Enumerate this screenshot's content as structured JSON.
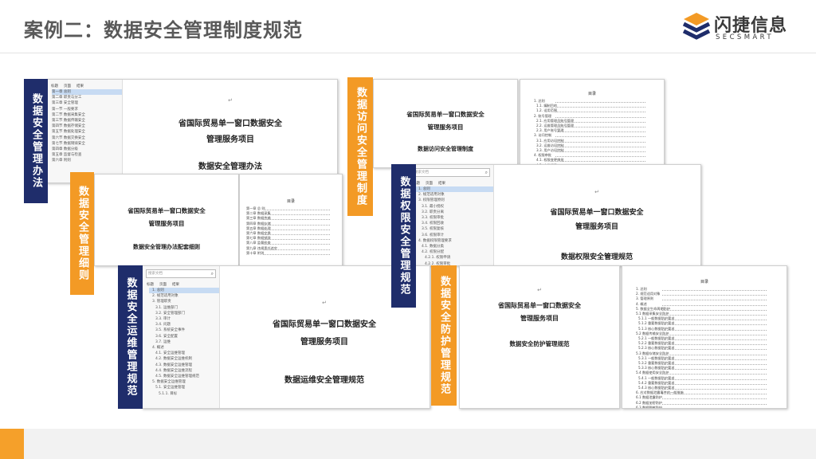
{
  "header": {
    "title": "案例二：数据安全管理制度规范"
  },
  "logo": {
    "name": "闪捷信息",
    "sub": "SECSMART"
  },
  "colors": {
    "navy": "#1f2d6b",
    "orange": "#f39a25"
  },
  "labels": {
    "l1": "数据安全管理办法",
    "l2": "数据安全管理细则",
    "l3": "数据访问安全管理制度",
    "l4": "数据权限安全管理规范",
    "l5": "数据安全运维管理规范",
    "l6": "数据安全防护管理规范"
  },
  "docs": {
    "d1": {
      "project1": "省国际贸易单一窗口数据安全",
      "project2": "管理服务项目",
      "name": "数据安全管理办法",
      "nav_tabs": [
        "标题",
        "页面",
        "结果"
      ],
      "nav_items": [
        "第一章 总则",
        "第二章 职责与分工",
        "第三章 安全管理",
        "第一节 一般要求",
        "第二节 数据采集安全",
        "第三节 数据传输安全",
        "第四节 数据存储安全",
        "第五节 数据处理安全",
        "第六节 数据交换安全",
        "第七节 数据销毁安全",
        "第四章 数据分级",
        "第五章 监督与检查",
        "第六章 附则"
      ]
    },
    "d2": {
      "project1": "省国际贸易单一窗口数据安全",
      "project2": "管理服务项目",
      "name": "数据安全管理办法配套细则",
      "toc_head": "目录",
      "toc": [
        "第一章 总 则",
        "第二章 数据采集",
        "第三章 数据传输",
        "第四章 数据存储",
        "第五章 数据处理",
        "第六章 数据交换",
        "第七章 数据销毁",
        "第八章 监督检查",
        "第九章 违规责任追究",
        "第十章 附则"
      ]
    },
    "d3": {
      "project1": "省国际贸易单一窗口数据安全",
      "project2": "管理服务项目",
      "name": "数据访问安全管理制度"
    },
    "d4": {
      "toc_head": "目录",
      "toc": [
        "1. 总则",
        "1.1. 编制目的",
        "1.2. 适用范围",
        "2. 账号管理",
        "2.1. 应用管理员账号管理",
        "2.2. 运维管理员账号管理",
        "2.3. 用户账号管理",
        "3. 访问控制",
        "3.1. 应用访问控制",
        "3.2. 运维访问控制",
        "3.3. 用户访问控制",
        "4. 权限审批",
        "4.1. 权限变更审批",
        "4.2. 审批记录"
      ]
    },
    "d5": {
      "project1": "省国际贸易单一窗口数据安全",
      "project2": "管理服务项目",
      "name": "数据权限安全管理规范",
      "search": "搜索文档",
      "nav_tabs": [
        "标题",
        "页面",
        "结果"
      ],
      "nav_items": [
        "1. 总则",
        "2. 规范适用对象",
        "3. 权限管理原则",
        "3.1. 最小授权",
        "3.2. 职责分离",
        "3.3. 权限审批",
        "3.4. 权限回收",
        "3.5. 权限复核",
        "3.6. 权限审计",
        "4. 数据权限管理要求",
        "4.1. 数据分类",
        "4.2. 权限分配",
        "4.2.1. 权限申请",
        "4.2.2. 权限审批",
        "4.3. 权限使用监控",
        "4.3.1. 权限变更"
      ]
    },
    "d6": {
      "project1": "省国际贸易单一窗口数据安全",
      "project2": "管理服务项目",
      "name": "数据运维安全管理规范",
      "search": "搜索文档",
      "nav_tabs": [
        "标题",
        "页面",
        "结果"
      ],
      "nav_items": [
        "1. 总则",
        "2. 规范适用对象",
        "3. 管理职责",
        "3.1. 运维部门",
        "3.2. 安全管理部门",
        "3.3. 审计",
        "3.4. 问题",
        "3.5. 系统安全事件",
        "3.6. 安全配置",
        "3.7. 运维",
        "4. 概述",
        "4.1. 安全运维管理",
        "4.2. 数据安全运维机制",
        "4.3. 数据安全运维管理",
        "4.4. 数据安全运维流程",
        "4.5. 数据安全运维管理规范",
        "5. 数据安全运维管理",
        "5.1. 安全运维管理",
        "5.1.1. 目标"
      ]
    },
    "d7": {
      "project1": "省国际贸易单一窗口数据安全",
      "project2": "管理服务项目",
      "name": "数据安全防护管理规范"
    },
    "d8": {
      "toc_head": "目录",
      "toc": [
        "1. 总则",
        "2. 规范适用对象",
        "3. 管理原则",
        "4. 概述",
        "5. 数据全生命周期防护",
        "5.1 数据采集安全防护",
        "5.1.1 一般数据防护要求",
        "5.1.2 重要数据防护要求",
        "5.1.3 核心数据防护要求",
        "5.2 数据传输安全防护",
        "5.2.1 一般数据防护要求",
        "5.2.2 重要数据防护要求",
        "5.2.3 核心数据防护要求",
        "5.3 数据存储安全防护",
        "5.3.1 一般数据防护要求",
        "5.3.2 重要数据防护要求",
        "5.3.3 核心数据防护要求",
        "5.4 数据使用安全防护",
        "5.4.1 一般数据防护要求",
        "5.4.2 重要数据防护要求",
        "5.4.3 核心数据防护要求",
        "6. 应对数据泄露事件的一般措施",
        "6.1 数据泄露防护",
        "6.2 数据加密防护",
        "6.3 数据脱敏防护",
        "6.4 数据备份防护",
        "7. 附则"
      ]
    }
  }
}
